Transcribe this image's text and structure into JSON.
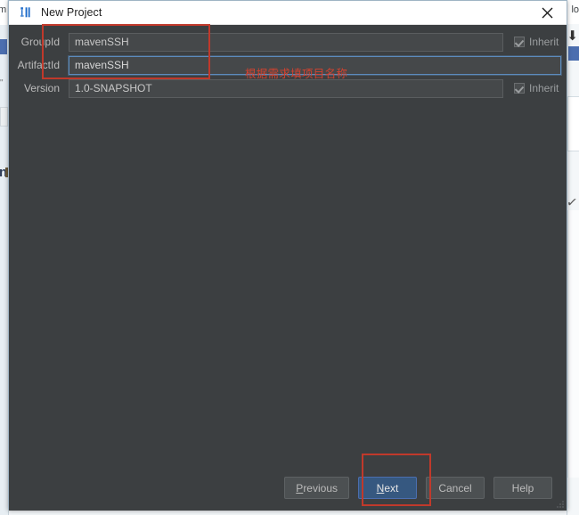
{
  "window": {
    "title": "New Project",
    "icon": "intellij-idea-icon",
    "close_label": "×"
  },
  "form": {
    "rows": [
      {
        "label": "GroupId",
        "value": "mavenSSH",
        "placeholder": "",
        "focused": false,
        "inherit": {
          "label": "Inherit",
          "checked": true,
          "enabled": false
        }
      },
      {
        "label": "ArtifactId",
        "value": "mavenSSH",
        "placeholder": "",
        "focused": true,
        "inherit": null
      },
      {
        "label": "Version",
        "value": "1.0-SNAPSHOT",
        "placeholder": "",
        "focused": false,
        "inherit": {
          "label": "Inherit",
          "checked": true,
          "enabled": false
        }
      }
    ]
  },
  "annotations": {
    "note_text": "根据需求填项目名称",
    "note_color": "#d4422f",
    "highlight_color": "#c0392b",
    "highlight_fields": "groupid-artifactid-fields",
    "highlight_button": "next-button"
  },
  "buttons": [
    {
      "label": "Previous",
      "mnemonic": "P",
      "primary": false
    },
    {
      "label": "Next",
      "mnemonic": "N",
      "primary": true
    },
    {
      "label": "Cancel",
      "mnemonic": "",
      "primary": false
    },
    {
      "label": "Help",
      "mnemonic": "",
      "primary": false
    }
  ],
  "background": {
    "left_fragment": "m",
    "right_fragment": "lo",
    "bold_fragment": "n",
    "quote_fragment": "\"",
    "check_fragment": "✓"
  },
  "colors": {
    "dialog_bg": "#3c3f41",
    "titlebar_bg": "#ffffff",
    "input_bg": "#45484a",
    "accent": "#365880",
    "focus_border": "#5c8bbd",
    "label_text": "#bbbbbb"
  }
}
